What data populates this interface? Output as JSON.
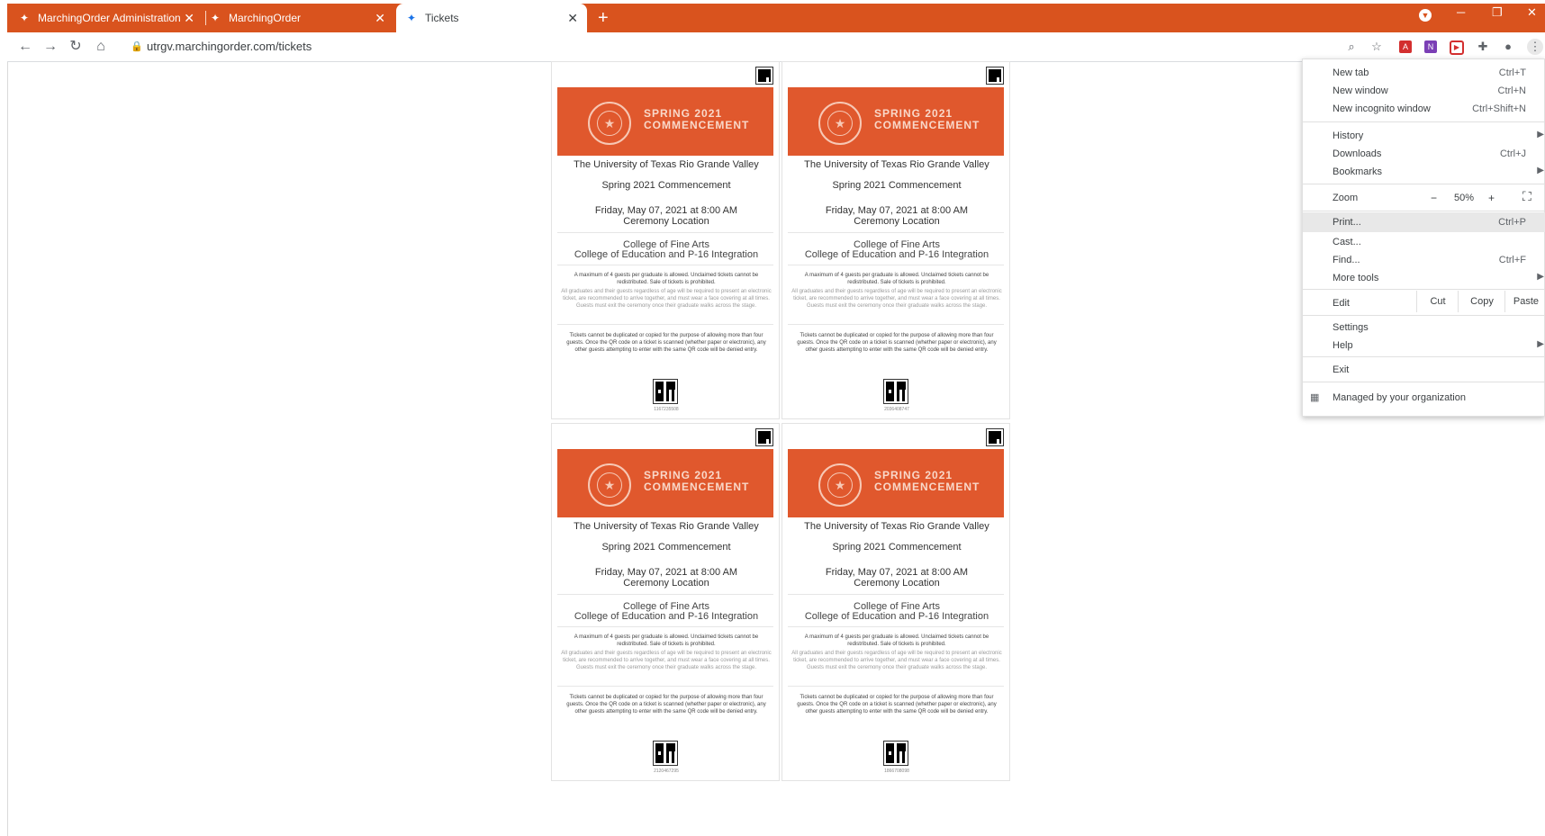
{
  "browser": {
    "tabs": [
      {
        "title": "MarchingOrder Administration",
        "active": false
      },
      {
        "title": "MarchingOrder",
        "active": false
      },
      {
        "title": "Tickets",
        "active": true
      }
    ],
    "new_tab_glyph": "+",
    "window_controls": {
      "minimize": "─",
      "restore": "❐",
      "close": "✕"
    },
    "url": "utrgv.marchingorder.com/tickets",
    "accent_color": "#d9531e"
  },
  "tickets": [
    {
      "banner_line1": "SPRING 2021",
      "banner_line2": "COMMENCEMENT",
      "university": "The University of Texas Rio Grande Valley",
      "event": "Spring 2021 Commencement",
      "date": "Friday, May 07, 2021 at 8:00 AM",
      "location": "Ceremony Location",
      "college1": "College of Fine Arts",
      "college2": "College of Education and P-16 Integration",
      "note1": "A maximum of 4 guests per graduate is allowed. Unclaimed tickets cannot be redistributed. Sale of tickets is prohibited.",
      "note2": "All graduates and their guests regardless of age will be required to present an electronic ticket, are recommended to arrive together, and must wear a face covering at all times. Guests must exit the ceremony once their graduate walks across the stage.",
      "note3": "Tickets cannot be duplicated or copied for the purpose of allowing more than four guests. Once the QR code on a ticket is scanned (whether paper or electronic), any other guests attempting to enter with the same QR code will be denied entry.",
      "code": "1167235508"
    },
    {
      "banner_line1": "SPRING 2021",
      "banner_line2": "COMMENCEMENT",
      "university": "The University of Texas Rio Grande Valley",
      "event": "Spring 2021 Commencement",
      "date": "Friday, May 07, 2021 at 8:00 AM",
      "location": "Ceremony Location",
      "college1": "College of Fine Arts",
      "college2": "College of Education and P-16 Integration",
      "note1": "A maximum of 4 guests per graduate is allowed. Unclaimed tickets cannot be redistributed. Sale of tickets is prohibited.",
      "note2": "All graduates and their guests regardless of age will be required to present an electronic ticket, are recommended to arrive together, and must wear a face covering at all times. Guests must exit the ceremony once their graduate walks across the stage.",
      "note3": "Tickets cannot be duplicated or copied for the purpose of allowing more than four guests. Once the QR code on a ticket is scanned (whether paper or electronic), any other guests attempting to enter with the same QR code will be denied entry.",
      "code": "2036408747"
    },
    {
      "banner_line1": "SPRING 2021",
      "banner_line2": "COMMENCEMENT",
      "university": "The University of Texas Rio Grande Valley",
      "event": "Spring 2021 Commencement",
      "date": "Friday, May 07, 2021 at 8:00 AM",
      "location": "Ceremony Location",
      "college1": "College of Fine Arts",
      "college2": "College of Education and P-16 Integration",
      "note1": "A maximum of 4 guests per graduate is allowed. Unclaimed tickets cannot be redistributed. Sale of tickets is prohibited.",
      "note2": "All graduates and their guests regardless of age will be required to present an electronic ticket, are recommended to arrive together, and must wear a face covering at all times. Guests must exit the ceremony once their graduate walks across the stage.",
      "note3": "Tickets cannot be duplicated or copied for the purpose of allowing more than four guests. Once the QR code on a ticket is scanned (whether paper or electronic), any other guests attempting to enter with the same QR code will be denied entry.",
      "code": "2120467295"
    },
    {
      "banner_line1": "SPRING 2021",
      "banner_line2": "COMMENCEMENT",
      "university": "The University of Texas Rio Grande Valley",
      "event": "Spring 2021 Commencement",
      "date": "Friday, May 07, 2021 at 8:00 AM",
      "location": "Ceremony Location",
      "college1": "College of Fine Arts",
      "college2": "College of Education and P-16 Integration",
      "note1": "A maximum of 4 guests per graduate is allowed. Unclaimed tickets cannot be redistributed. Sale of tickets is prohibited.",
      "note2": "All graduates and their guests regardless of age will be required to present an electronic ticket, are recommended to arrive together, and must wear a face covering at all times. Guests must exit the ceremony once their graduate walks across the stage.",
      "note3": "Tickets cannot be duplicated or copied for the purpose of allowing more than four guests. Once the QR code on a ticket is scanned (whether paper or electronic), any other guests attempting to enter with the same QR code will be denied entry.",
      "code": "1866708098"
    }
  ],
  "menu": {
    "new_tab": {
      "label": "New tab",
      "shortcut": "Ctrl+T"
    },
    "new_window": {
      "label": "New window",
      "shortcut": "Ctrl+N"
    },
    "new_incognito": {
      "label": "New incognito window",
      "shortcut": "Ctrl+Shift+N"
    },
    "history": {
      "label": "History"
    },
    "downloads": {
      "label": "Downloads",
      "shortcut": "Ctrl+J"
    },
    "bookmarks": {
      "label": "Bookmarks"
    },
    "zoom": {
      "label": "Zoom",
      "minus": "−",
      "value": "50%",
      "plus": "+"
    },
    "print": {
      "label": "Print...",
      "shortcut": "Ctrl+P"
    },
    "cast": {
      "label": "Cast..."
    },
    "find": {
      "label": "Find...",
      "shortcut": "Ctrl+F"
    },
    "more_tools": {
      "label": "More tools"
    },
    "edit": {
      "label": "Edit",
      "cut": "Cut",
      "copy": "Copy",
      "paste": "Paste"
    },
    "settings": {
      "label": "Settings"
    },
    "help": {
      "label": "Help"
    },
    "exit": {
      "label": "Exit"
    },
    "managed": {
      "label": "Managed by your organization"
    }
  }
}
